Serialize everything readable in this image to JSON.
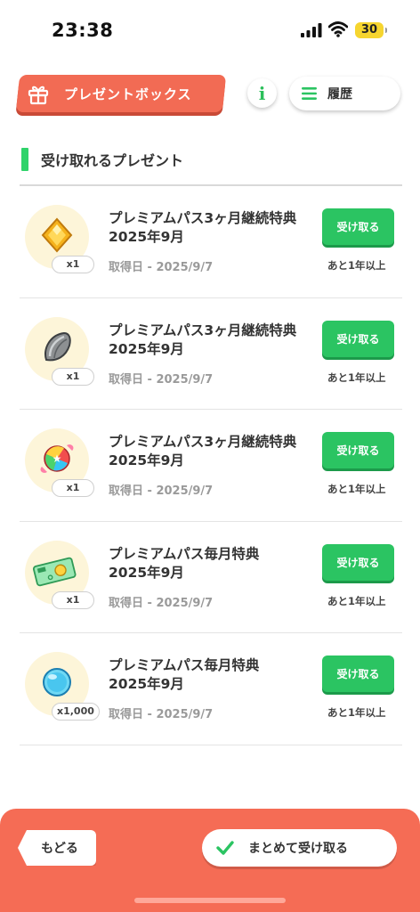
{
  "status_bar": {
    "time": "23:38",
    "battery": "30"
  },
  "header": {
    "title": "プレゼントボックス",
    "info_label": "i",
    "history_label": "履歴"
  },
  "section": {
    "title": "受け取れるプレゼント"
  },
  "presents": [
    {
      "icon": "gold-gem-icon",
      "quantity": "x1",
      "title": "プレミアムパス3ヶ月継続特典\n2025年9月",
      "date": "取得日 - 2025/9/7",
      "button_label": "受け取る",
      "expires": "あと1年以上"
    },
    {
      "icon": "sunflower-seed-icon",
      "quantity": "x1",
      "title": "プレミアムパス3ヶ月継続特典\n2025年9月",
      "date": "取得日 - 2025/9/7",
      "button_label": "受け取る",
      "expires": "あと1年以上"
    },
    {
      "icon": "star-candy-icon",
      "quantity": "x1",
      "title": "プレミアムパス3ヶ月継続特典\n2025年9月",
      "date": "取得日 - 2025/9/7",
      "button_label": "受け取る",
      "expires": "あと1年以上"
    },
    {
      "icon": "ticket-icon",
      "quantity": "x1",
      "title": "プレミアムパス毎月特典\n2025年9月",
      "date": "取得日 - 2025/9/7",
      "button_label": "受け取る",
      "expires": "あと1年以上"
    },
    {
      "icon": "blue-orb-icon",
      "quantity": "x1,000",
      "title": "プレミアムパス毎月特典\n2025年9月",
      "date": "取得日 - 2025/9/7",
      "button_label": "受け取る",
      "expires": "あと1年以上"
    }
  ],
  "footer": {
    "back_label": "もどる",
    "receive_all_label": "まとめて受け取る"
  },
  "colors": {
    "accent": "#f26b54",
    "button_green": "#2bc462",
    "section_bar": "#2fd36a"
  }
}
